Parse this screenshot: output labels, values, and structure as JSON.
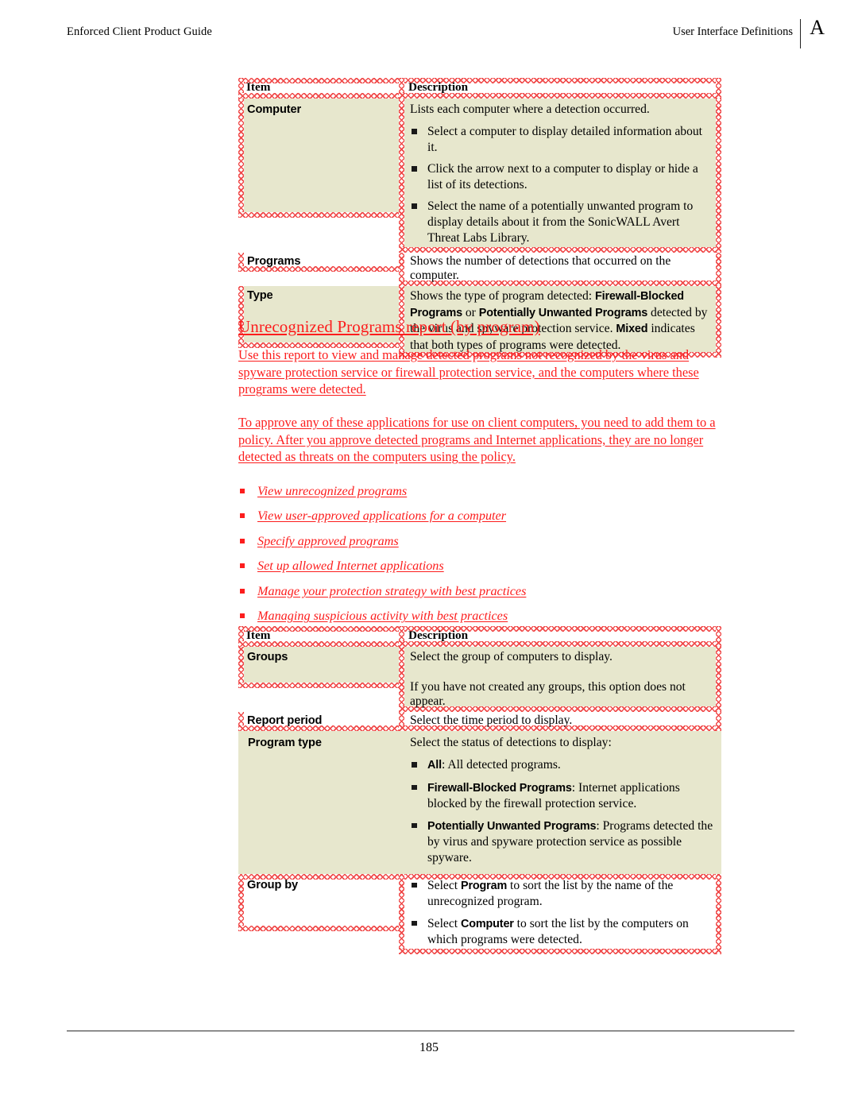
{
  "header": {
    "left_title": "Enforced Client Product Guide",
    "right_title": "User Interface Definitions",
    "appendix_letter": "A"
  },
  "footer": {
    "page_number": "185"
  },
  "colors": {
    "revision_red": "#fc1d1d",
    "hatch_red": "#f04a4a",
    "cell_fill": "#e7e7cd",
    "text_black": "#000000"
  },
  "table_top": {
    "headers": {
      "item": "Item",
      "description": "Description"
    },
    "rows": [
      {
        "item": "Computer",
        "intro": "Lists each computer where a detection occurred.",
        "bullets": [
          "Select a computer to display detailed information about it.",
          "Click the arrow next to a computer to display or hide a list of its detections.",
          "Select the name of a potentially unwanted program to display details about it from the SonicWALL Avert Threat Labs Library."
        ]
      },
      {
        "item": "Programs",
        "description": "Shows the number of detections that occurred on the computer."
      },
      {
        "item": "Type",
        "desc_part1": "Shows the type of program detected: ",
        "term1": "Firewall-Blocked Programs",
        "desc_part2": " or ",
        "term2": "Potentially Unwanted Programs",
        "desc_part3": " detected by the virus and spyware protection service. ",
        "term3": "Mixed",
        "desc_part4": " indicates that both types of programs were detected."
      }
    ]
  },
  "section": {
    "title": "Unrecognized Programs report (by program)",
    "paragraph1": "Use this report to view and manage detected programs not recognized by the virus and spyware protection service or firewall protection service, and the computers where these programs were detected.",
    "paragraph2": "To approve any of these applications for use on client computers, you need to add them to a policy. After you approve detected programs and Internet applications, they are no longer detected as threats on the computers using the policy.",
    "links": [
      "View unrecognized programs",
      "View user-approved applications for a computer",
      "Specify approved programs",
      "Set up allowed Internet applications",
      "Manage your protection strategy with best practices",
      "Managing suspicious activity with best practices"
    ]
  },
  "table_bottom": {
    "headers": {
      "item": "Item",
      "description": "Description"
    },
    "rows": [
      {
        "item": "Groups",
        "line1": "Select the group of computers to display.",
        "line2": "If you have not created any groups, this option does not appear."
      },
      {
        "item": "Report period",
        "description": "Select the time period to display."
      },
      {
        "item": "Program type",
        "intro": "Select the status of detections to display:",
        "bullets": [
          {
            "term": "All",
            "text": ": All detected programs."
          },
          {
            "term": "Firewall-Blocked Programs",
            "text": ": Internet applications blocked by the firewall protection service."
          },
          {
            "term": "Potentially Unwanted Programs",
            "text": ": Programs detected the by virus and spyware protection service as possible spyware."
          }
        ]
      },
      {
        "item": "Group by",
        "bullets": [
          {
            "pre": "Select ",
            "term": "Program",
            "post": " to sort the list by the name of the unrecognized program."
          },
          {
            "pre": "Select ",
            "term": "Computer",
            "post": " to sort the list by the computers on which programs were detected."
          }
        ]
      }
    ]
  }
}
